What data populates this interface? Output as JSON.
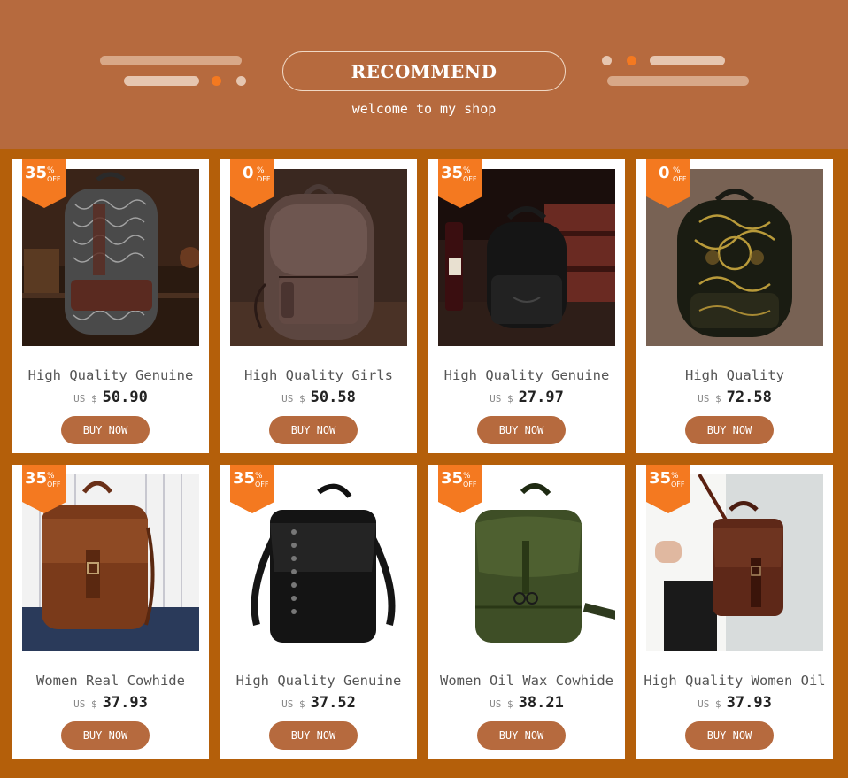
{
  "header": {
    "title": "RECOMMEND",
    "subtitle": "welcome to my shop"
  },
  "colors": {
    "header_bg": "#b66a3e",
    "grid_bg": "#b45f0a",
    "badge": "#f47920",
    "button": "#b66a3e",
    "accent_dot": "#f47920"
  },
  "products": [
    {
      "name": "High Quality Genuine",
      "currency": "US $",
      "price": "50.90",
      "discount": "35",
      "pct": "%",
      "off": "OFF",
      "button": "BUY NOW",
      "image": "embossed-black-leather-backpack"
    },
    {
      "name": "High Quality Girls",
      "currency": "US $",
      "price": "50.58",
      "discount": "0",
      "pct": "%",
      "off": "OFF",
      "button": "BUY NOW",
      "image": "brown-leather-backpack"
    },
    {
      "name": "High Quality Genuine",
      "currency": "US $",
      "price": "27.97",
      "discount": "35",
      "pct": "%",
      "off": "OFF",
      "button": "BUY NOW",
      "image": "small-black-backpack"
    },
    {
      "name": "High Quality",
      "currency": "US $",
      "price": "72.58",
      "discount": "0",
      "pct": "%",
      "off": "OFF",
      "button": "BUY NOW",
      "image": "painted-floral-backpack"
    },
    {
      "name": "Women Real Cowhide",
      "currency": "US $",
      "price": "37.93",
      "discount": "35",
      "pct": "%",
      "off": "OFF",
      "button": "BUY NOW",
      "image": "brown-flap-backpack-model"
    },
    {
      "name": "High Quality Genuine",
      "currency": "US $",
      "price": "37.52",
      "discount": "35",
      "pct": "%",
      "off": "OFF",
      "button": "BUY NOW",
      "image": "black-studded-backpack"
    },
    {
      "name": "Women Oil Wax Cowhide",
      "currency": "US $",
      "price": "38.21",
      "discount": "35",
      "pct": "%",
      "off": "OFF",
      "button": "BUY NOW",
      "image": "green-flap-backpack"
    },
    {
      "name": "High Quality Women Oil",
      "currency": "US $",
      "price": "37.93",
      "discount": "35",
      "pct": "%",
      "off": "OFF",
      "button": "BUY NOW",
      "image": "brown-backpack-model"
    }
  ]
}
